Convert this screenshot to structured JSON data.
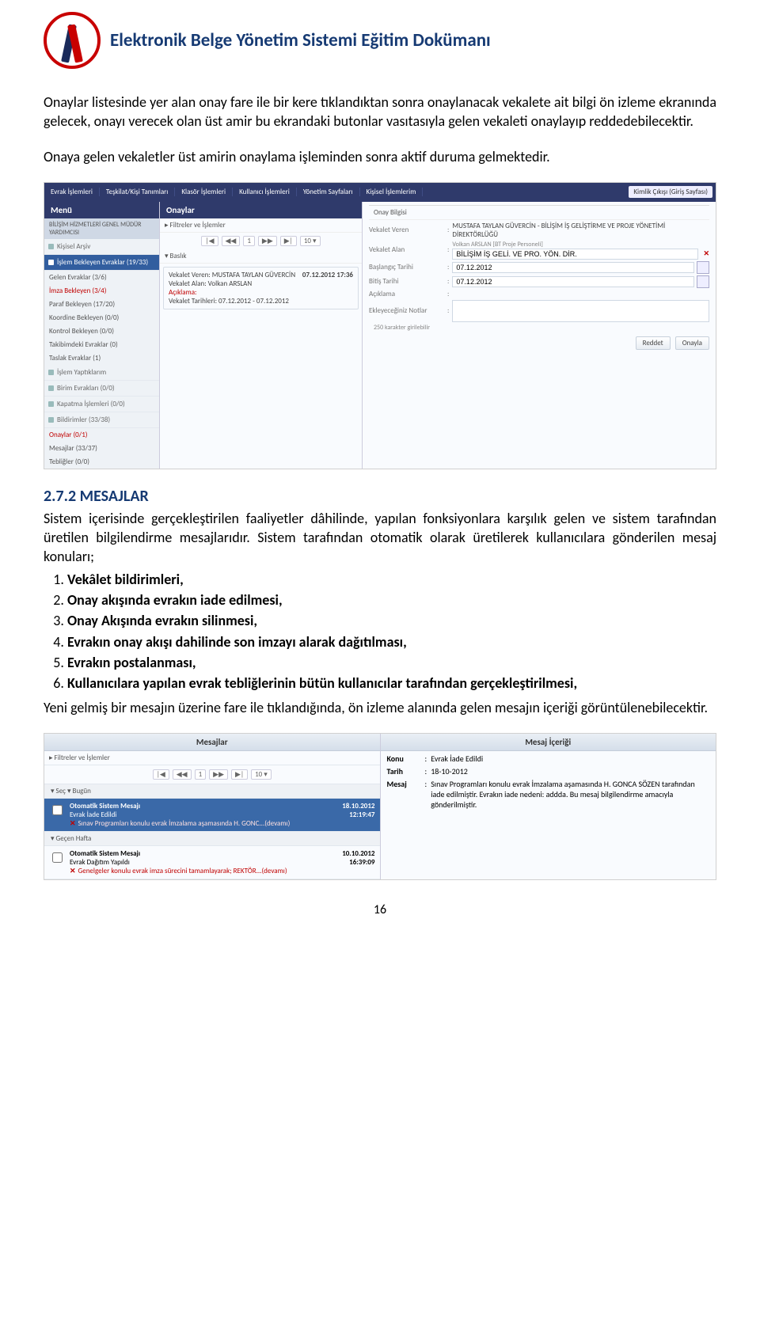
{
  "header_title": "Elektronik Belge Yönetim Sistemi Eğitim Dokümanı",
  "p1": "Onaylar listesinde yer alan onay fare ile bir kere tıklandıktan sonra onaylanacak vekalete ait bilgi ön izleme ekranında gelecek, onayı verecek olan üst amir bu ekrandaki butonlar vasıtasıyla gelen vekaleti onaylayıp reddedebilecektir.",
  "p2": "Onaya gelen vekaletler üst amirin onaylama işleminden sonra aktif duruma gelmektedir.",
  "sec_h": "2.7.2   MESAJLAR",
  "sec_p1": "Sistem içerisinde gerçekleştirilen faaliyetler dâhilinde, yapılan fonksiyonlara karşılık gelen ve sistem tarafından üretilen bilgilendirme mesajlarıdır. Sistem tarafından otomatik olarak üretilerek kullanıcılara gönderilen mesaj konuları;",
  "items": {
    "i1": "Vekâlet bildirimleri,",
    "i2": "Onay akışında evrakın iade edilmesi,",
    "i3": "Onay Akışında evrakın silinmesi,",
    "i4": "Evrakın onay akışı dahilinde son imzayı alarak dağıtılması,",
    "i5": "Evrakın postalanması,",
    "i6": "Kullanıcılara yapılan evrak tebliğlerinin bütün kullanıcılar tarafından gerçekleştirilmesi,"
  },
  "sec_p2": "Yeni gelmiş bir mesajın üzerine fare ile tıklandığında, ön izleme alanında gelen mesajın içeriği görüntülenebilecektir.",
  "page_no": "16",
  "s1": {
    "tabs": {
      "t1": "Evrak İşlemleri",
      "t2": "Teşkilat/Kişi Tanımları",
      "t3": "Klasör İşlemleri",
      "t4": "Kullanıcı İşlemleri",
      "t5": "Yönetim Sayfaları",
      "t6": "Kişisel İşlemlerim"
    },
    "logout": "Kimlik Çıkışı\n(Giriş Sayfası)",
    "menu_h": "Menü",
    "menu_note": "BİLİŞİM HİZMETLERİ GENEL MÜDÜR YARDIMCISI",
    "menu": {
      "m0": "Kişisel Arşiv",
      "m1": "İşlem Bekleyen Evraklar (19/33)",
      "m2": "Gelen Evraklar (3/6)",
      "m3": "İmza Bekleyen (3/4)",
      "m4": "Paraf Bekleyen (17/20)",
      "m5": "Koordine Bekleyen (0/0)",
      "m6": "Kontrol Bekleyen (0/0)",
      "m7": "Takibimdeki Evraklar (0)",
      "m8": "Taslak Evraklar (1)",
      "m9": "İşlem Yaptıklarım",
      "m10": "Birim Evrakları (0/0)",
      "m11": "Kapatma İşlemleri (0/0)",
      "m12": "Bildirimler (33/38)",
      "m13": "Onaylar (0/1)",
      "m14": "Mesajlar (33/37)",
      "m15": "Tebliğler (0/0)"
    },
    "mid_h": "Onaylar",
    "mid_filters": "▸ Filtreler ve İşlemler",
    "pager": {
      "first": "|◀",
      "prev": "◀◀",
      "page": "1",
      "next": "▶▶",
      "last": "▶|",
      "size": "10",
      "arrow": "▾"
    },
    "mid_sec": "▾ Baslık",
    "card": {
      "l1": "Vekalet Veren: MUSTAFA TAYLAN GÜVERCİN",
      "l2": "Vekalet Alan: Volkan ARSLAN",
      "l3": "Açıklama:",
      "l4": "Vekalet Tarihleri: 07.12.2012 - 07.12.2012",
      "date": "07.12.2012 17:36"
    },
    "right_h": "Onay Bilgisi",
    "f": {
      "f1": {
        "lbl": "Vekalet Veren",
        "val": "MUSTAFA TAYLAN GÜVERCİN - BİLİŞİM İŞ GELİŞTİRME VE PROJE YÖNETİMİ DİREKTÖRLÜĞÜ"
      },
      "f2": {
        "lbl": "Vekalet Alan",
        "val_top": "Volkan ARSLAN [BT Proje Personeli]",
        "val": "BİLİŞİM İŞ GELİ. VE PRO. YÖN. DİR."
      },
      "f3": {
        "lbl": "Başlangıç Tarihi",
        "val": "07.12.2012"
      },
      "f4": {
        "lbl": "Bitiş Tarihi",
        "val": "07.12.2012"
      },
      "f5": {
        "lbl": "Açıklama"
      },
      "f6": {
        "lbl": "Ekleyeceğiniz Notlar"
      },
      "note": "250 karakter girilebilir"
    },
    "btn_reject": "Reddet",
    "btn_approve": "Onayla"
  },
  "s2": {
    "left_h": "Mesajlar",
    "right_h": "Mesaj İçeriği",
    "filters": "▸ Filtreler ve İşlemler",
    "pager": {
      "first": "|◀",
      "prev": "◀◀",
      "page": "1",
      "next": "▶▶",
      "last": "▶|",
      "size": "10",
      "arrow": "▾"
    },
    "grp1": "▾ Seç     ▾ Bugün",
    "grp2": "▾ Geçen Hafta",
    "row1": {
      "t1": "Otomatik Sistem Mesajı",
      "t2": "Evrak İade Edildi",
      "t3": "Sınav Programları konulu evrak İmzalama aşamasında H. GONC...(devamı)",
      "d": "18.10.2012",
      "t": "12:19:47"
    },
    "row2": {
      "t1": "Otomatik Sistem Mesajı",
      "t2": "Evrak Dağıtım Yapıldı",
      "t3": "Genelgeler konulu evrak imza sürecini tamamlayarak; REKTÖR...(devamı)",
      "d": "10.10.2012",
      "t": "16:39:09"
    },
    "detail": {
      "k1": "Konu",
      "v1": "Evrak İade Edildi",
      "k2": "Tarih",
      "v2": "18-10-2012",
      "k3": "Mesaj",
      "v3": "Sınav Programları konulu evrak İmzalama aşamasında H. GONCA SÖZEN tarafından iade edilmiştir. Evrakın iade nedeni: addda. Bu mesaj bilgilendirme amacıyla gönderilmiştir."
    }
  }
}
